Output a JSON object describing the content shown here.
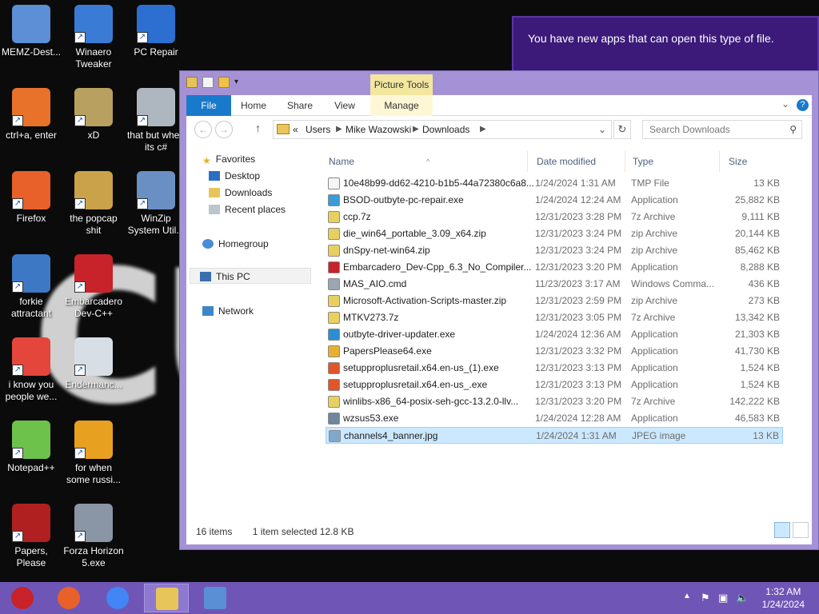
{
  "desktop": {
    "icons": [
      {
        "label": "MEMZ-Dest...",
        "icon": "recycle-bin-icon"
      },
      {
        "label": "Winaero Tweaker",
        "icon": "winaero-icon"
      },
      {
        "label": "PC Repair",
        "icon": "pc-repair-shield-icon"
      },
      {
        "label": "ctrl+a, enter",
        "icon": "orange-ring-icon"
      },
      {
        "label": "xD",
        "icon": "hxd-icon"
      },
      {
        "label": "that but when its c#",
        "icon": "cubes-icon"
      },
      {
        "label": "Firefox",
        "icon": "firefox-icon"
      },
      {
        "label": "the popcap shit",
        "icon": "popcap-icon"
      },
      {
        "label": "WinZip System Util...",
        "icon": "winzip-icon"
      },
      {
        "label": "forkie attractant",
        "icon": "monitor-gear-icon"
      },
      {
        "label": "Embarcadero Dev-C++",
        "icon": "devcpp-icon"
      },
      {
        "label": "i know you people we...",
        "icon": "chrome-icon"
      },
      {
        "label": "Endermanc...",
        "icon": "window-app-icon"
      },
      {
        "label": "Notepad++",
        "icon": "notepadpp-icon"
      },
      {
        "label": "for when some russi...",
        "icon": "die-icon"
      },
      {
        "label": "Papers, Please",
        "icon": "papers-please-icon"
      },
      {
        "label": "Forza Horizon 5.exe",
        "icon": "flash-icon"
      }
    ],
    "wallpaper_text": "CU"
  },
  "toast": {
    "message": "You have new apps that can open this type of file."
  },
  "explorer": {
    "context_tab_group": "Picture Tools",
    "tabs": {
      "file": "File",
      "home": "Home",
      "share": "Share",
      "view": "View",
      "manage": "Manage"
    },
    "address": {
      "overflow": "«",
      "crumbs": [
        "Users",
        "Mike Wazowski",
        "Downloads"
      ]
    },
    "search_placeholder": "Search Downloads",
    "nav": {
      "favorites": "Favorites",
      "desktop": "Desktop",
      "downloads": "Downloads",
      "recent": "Recent places",
      "homegroup": "Homegroup",
      "thispc": "This PC",
      "network": "Network"
    },
    "columns": {
      "name": "Name",
      "date": "Date modified",
      "type": "Type",
      "size": "Size"
    },
    "files": [
      {
        "name": "10e48b99-dd62-4210-b1b5-44a72380c6a8...",
        "date": "1/24/2024 1:31 AM",
        "type": "TMP File",
        "size": "13 KB",
        "color": "#f5f5f5"
      },
      {
        "name": "BSOD-outbyte-pc-repair.exe",
        "date": "1/24/2024 12:24 AM",
        "type": "Application",
        "size": "25,882 KB",
        "color": "#3a9bd9"
      },
      {
        "name": "ccp.7z",
        "date": "12/31/2023 3:28 PM",
        "type": "7z Archive",
        "size": "9,111 KB",
        "color": "#e8d060"
      },
      {
        "name": "die_win64_portable_3.09_x64.zip",
        "date": "12/31/2023 3:24 PM",
        "type": "zip Archive",
        "size": "20,144 KB",
        "color": "#e8d060"
      },
      {
        "name": "dnSpy-net-win64.zip",
        "date": "12/31/2023 3:24 PM",
        "type": "zip Archive",
        "size": "85,462 KB",
        "color": "#e8d060"
      },
      {
        "name": "Embarcadero_Dev-Cpp_6.3_No_Compiler...",
        "date": "12/31/2023 3:20 PM",
        "type": "Application",
        "size": "8,288 KB",
        "color": "#c8222b"
      },
      {
        "name": "MAS_AIO.cmd",
        "date": "11/23/2023 3:17 AM",
        "type": "Windows Comma...",
        "size": "436 KB",
        "color": "#9aa6b2"
      },
      {
        "name": "Microsoft-Activation-Scripts-master.zip",
        "date": "12/31/2023 2:59 PM",
        "type": "zip Archive",
        "size": "273 KB",
        "color": "#e8d060"
      },
      {
        "name": "MTKV273.7z",
        "date": "12/31/2023 3:05 PM",
        "type": "7z Archive",
        "size": "13,342 KB",
        "color": "#e8d060"
      },
      {
        "name": "outbyte-driver-updater.exe",
        "date": "1/24/2024 12:36 AM",
        "type": "Application",
        "size": "21,303 KB",
        "color": "#2a8fd0"
      },
      {
        "name": "PapersPlease64.exe",
        "date": "12/31/2023 3:32 PM",
        "type": "Application",
        "size": "41,730 KB",
        "color": "#e8b030"
      },
      {
        "name": "setupproplusretail.x64.en-us_(1).exe",
        "date": "12/31/2023 3:13 PM",
        "type": "Application",
        "size": "1,524 KB",
        "color": "#e0552a"
      },
      {
        "name": "setupproplusretail.x64.en-us_.exe",
        "date": "12/31/2023 3:13 PM",
        "type": "Application",
        "size": "1,524 KB",
        "color": "#e0552a"
      },
      {
        "name": "winlibs-x86_64-posix-seh-gcc-13.2.0-llv...",
        "date": "12/31/2023 3:20 PM",
        "type": "7z Archive",
        "size": "142,222 KB",
        "color": "#e8d060"
      },
      {
        "name": "wzsus53.exe",
        "date": "1/24/2024 12:28 AM",
        "type": "Application",
        "size": "46,583 KB",
        "color": "#6f85a0"
      },
      {
        "name": "channels4_banner.jpg",
        "date": "1/24/2024 1:31 AM",
        "type": "JPEG image",
        "size": "13 KB",
        "color": "#7fa8c9"
      }
    ],
    "selected_index": 15,
    "status": {
      "items": "16 items",
      "selected": "1 item selected  12.8 KB"
    }
  },
  "taskbar": {
    "items": [
      "memz-ball-icon",
      "firefox-icon",
      "chrome-icon",
      "file-explorer-icon",
      "control-panel-icon"
    ],
    "active_index": 3,
    "clock_time": "1:32 AM",
    "clock_date": "1/24/2024"
  }
}
